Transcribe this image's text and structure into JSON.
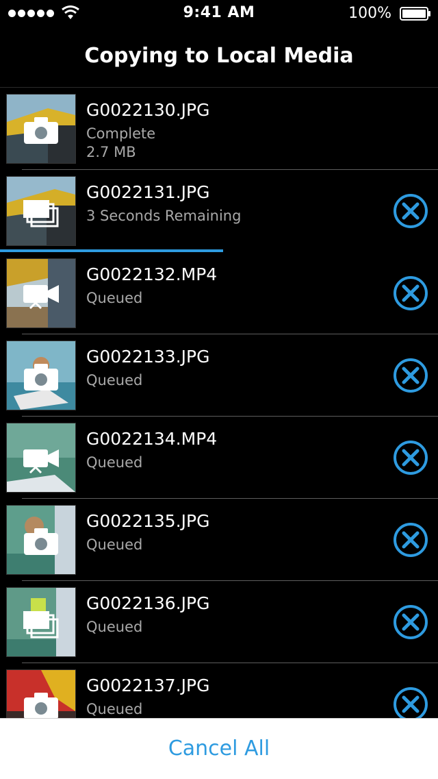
{
  "status_bar": {
    "time": "9:41 AM",
    "battery": "100%"
  },
  "nav": {
    "title": "Copying to Local Media"
  },
  "accent_color": "#2e9be0",
  "items": [
    {
      "name": "G0022130.JPG",
      "status": "Complete",
      "size": "2.7 MB",
      "type_icon": "camera-icon",
      "cancellable": false
    },
    {
      "name": "G0022131.JPG",
      "status": "3 Seconds Remaining",
      "type_icon": "burst-icon",
      "cancellable": true,
      "progress": 0.51
    },
    {
      "name": "G0022132.MP4",
      "status": "Queued",
      "type_icon": "video-icon",
      "cancellable": true
    },
    {
      "name": "G0022133.JPG",
      "status": "Queued",
      "type_icon": "camera-icon",
      "cancellable": true
    },
    {
      "name": "G0022134.MP4",
      "status": "Queued",
      "type_icon": "video-icon",
      "cancellable": true
    },
    {
      "name": "G0022135.JPG",
      "status": "Queued",
      "type_icon": "camera-icon",
      "cancellable": true
    },
    {
      "name": "G0022136.JPG",
      "status": "Queued",
      "type_icon": "burst-icon",
      "cancellable": true
    },
    {
      "name": "G0022137.JPG",
      "status": "Queued",
      "type_icon": "camera-icon",
      "cancellable": true
    }
  ],
  "footer": {
    "cancel_all_label": "Cancel All"
  }
}
